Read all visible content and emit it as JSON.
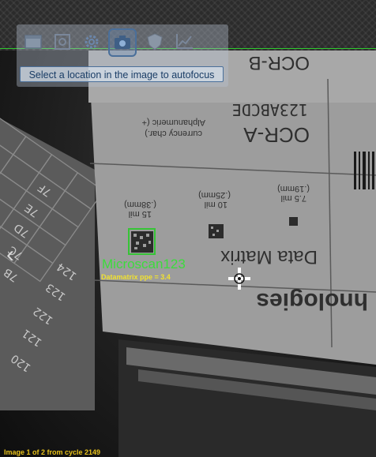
{
  "toolbar": {
    "buttons": [
      {
        "name": "display-mode-icon",
        "active": false
      },
      {
        "name": "zoom-fit-icon",
        "active": false
      },
      {
        "name": "settings-gear-icon",
        "active": false
      },
      {
        "name": "camera-autofocus-icon",
        "active": true
      },
      {
        "name": "shield-icon",
        "active": false
      },
      {
        "name": "chart-trend-icon",
        "active": false
      }
    ],
    "autofocus_hint": "Select a location in the image to autofocus"
  },
  "decode": {
    "result_text": "Microscan123",
    "ppe_text": "Datamatrix ppe = 3.4"
  },
  "status": {
    "text": "Image 1 of 2 from cycle 2149"
  },
  "scene": {
    "grid_labels": [
      "7F",
      "7E",
      "7D",
      "7C",
      "7B",
      "124",
      "123",
      "122",
      "121",
      "120"
    ],
    "card": {
      "ocr_b": "OCR-B",
      "ocr_a": "OCR-A",
      "ocr_a_sample": "123ABCDE",
      "alpha_note_1": "Alphanumeric (+",
      "alpha_note_2": "currency char.)",
      "data_matrix": "Data Matrix",
      "size_15": "15 mil",
      "size_15_mm": "(.38mm)",
      "size_10": "10 mil",
      "size_10_mm": "(.25mm)",
      "size_7": "7.5 mil",
      "size_7_mm": "(.19mm)",
      "bottom_word": "hnologies"
    }
  },
  "colors": {
    "accent_green": "#36c436",
    "status_yellow": "#e8c21a",
    "hint_text": "#1a3d66"
  }
}
